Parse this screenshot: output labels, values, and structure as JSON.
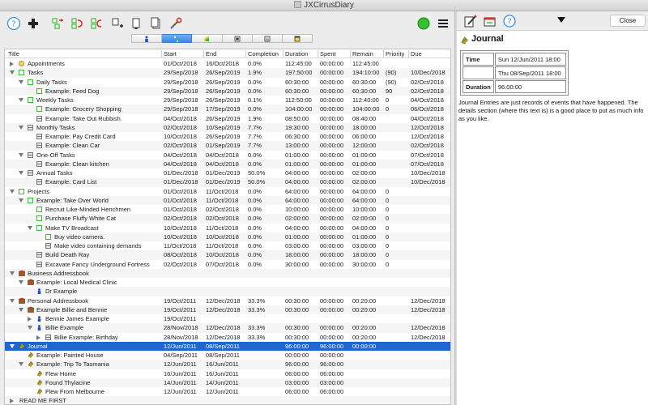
{
  "window": {
    "title": "JXCirrusDiary"
  },
  "toolbar": {
    "buttons": [
      "help-icon",
      "add-icon",
      "move-icon",
      "undo-icon",
      "redo-icon",
      "new-task-icon",
      "copy-icon",
      "paste-icon",
      "wrench-icon"
    ],
    "status_color": "#33c12f"
  },
  "tabs": [
    {
      "name": "person-tab"
    },
    {
      "name": "tree-tab"
    },
    {
      "name": "chart-tab"
    },
    {
      "name": "calendar-tab"
    },
    {
      "name": "week-tab"
    },
    {
      "name": "month-tab"
    }
  ],
  "table": {
    "headers": {
      "title": "Title",
      "start": "Start",
      "end": "End",
      "completion": "Completion",
      "duration": "Duration",
      "spent": "Spent",
      "remain": "Remain",
      "priority": "Priority",
      "due": "Due"
    },
    "rows": [
      {
        "indent": 0,
        "tri": "closed",
        "icon": "clock",
        "title": "Appointments",
        "start": "01/Oct/2018",
        "end": "16/Oct/2018",
        "completion": "0.0%",
        "duration": "112:45:00",
        "spent": "00:00:00",
        "remain": "112:45:00",
        "priority": "",
        "due": ""
      },
      {
        "indent": 0,
        "tri": "open",
        "icon": "task",
        "title": "Tasks",
        "start": "29/Sep/2018",
        "end": "26/Sep/2019",
        "completion": "1.9%",
        "duration": "197:50:00",
        "spent": "00:00:00",
        "remain": "194:10:00",
        "priority": "(90)",
        "due": "10/Dec/2018"
      },
      {
        "indent": 1,
        "tri": "open",
        "icon": "task",
        "title": "Daily Tasks",
        "start": "29/Sep/2018",
        "end": "26/Sep/2019",
        "completion": "0.0%",
        "duration": "60:30:00",
        "spent": "00:00:00",
        "remain": "60:30:00",
        "priority": "(90)",
        "due": "02/Oct/2018"
      },
      {
        "indent": 2,
        "tri": "",
        "icon": "task",
        "title": "Example: Feed Dog",
        "start": "29/Sep/2018",
        "end": "26/Sep/2019",
        "completion": "0.0%",
        "duration": "60:30:00",
        "spent": "00:00:00",
        "remain": "60:30:00",
        "priority": "90",
        "due": "02/Oct/2018"
      },
      {
        "indent": 1,
        "tri": "open",
        "icon": "task",
        "title": "Weekly Tasks",
        "start": "29/Sep/2018",
        "end": "26/Sep/2019",
        "completion": "0.1%",
        "duration": "112:50:00",
        "spent": "00:00:00",
        "remain": "112:40:00",
        "priority": "0",
        "due": "04/Oct/2018"
      },
      {
        "indent": 2,
        "tri": "",
        "icon": "task",
        "title": "Example: Grocery Shopping",
        "start": "29/Sep/2018",
        "end": "17/Sep/2019",
        "completion": "0.0%",
        "duration": "104:00:00",
        "spent": "00:00:00",
        "remain": "104:00:00",
        "priority": "0",
        "due": "06/Oct/2018"
      },
      {
        "indent": 2,
        "tri": "",
        "icon": "cal",
        "title": "Example: Take Out Rubbish",
        "start": "04/Oct/2018",
        "end": "26/Sep/2019",
        "completion": "1.9%",
        "duration": "08:50:00",
        "spent": "00:00:00",
        "remain": "08:40:00",
        "priority": "",
        "due": "04/Oct/2018"
      },
      {
        "indent": 1,
        "tri": "open",
        "icon": "cal",
        "title": "Monthly Tasks",
        "start": "02/Oct/2018",
        "end": "10/Sep/2019",
        "completion": "7.7%",
        "duration": "19:30:00",
        "spent": "00:00:00",
        "remain": "18:00:00",
        "priority": "",
        "due": "12/Oct/2018"
      },
      {
        "indent": 2,
        "tri": "",
        "icon": "cal",
        "title": "Example: Pay Credit Card",
        "start": "10/Oct/2018",
        "end": "26/Sep/2019",
        "completion": "7.7%",
        "duration": "06:30:00",
        "spent": "00:00:00",
        "remain": "06:00:00",
        "priority": "",
        "due": "12/Oct/2018"
      },
      {
        "indent": 2,
        "tri": "",
        "icon": "cal",
        "title": "Example: Clean Car",
        "start": "02/Oct/2018",
        "end": "01/Sep/2019",
        "completion": "7.7%",
        "duration": "13:00:00",
        "spent": "00:00:00",
        "remain": "12:00:00",
        "priority": "",
        "due": "02/Oct/2018"
      },
      {
        "indent": 1,
        "tri": "open",
        "icon": "cal",
        "title": "One-Off Tasks",
        "start": "04/Oct/2018",
        "end": "04/Oct/2018",
        "completion": "0.0%",
        "duration": "01:00:00",
        "spent": "00:00:00",
        "remain": "01:00:00",
        "priority": "",
        "due": "07/Oct/2018"
      },
      {
        "indent": 2,
        "tri": "",
        "icon": "cal",
        "title": "Example: Clean kitchen",
        "start": "04/Oct/2018",
        "end": "04/Oct/2018",
        "completion": "0.0%",
        "duration": "01:00:00",
        "spent": "00:00:00",
        "remain": "01:00:00",
        "priority": "",
        "due": "07/Oct/2018"
      },
      {
        "indent": 1,
        "tri": "open",
        "icon": "cal",
        "title": "Annual Tasks",
        "start": "01/Dec/2018",
        "end": "01/Dec/2019",
        "completion": "50.0%",
        "duration": "04:00:00",
        "spent": "00:00:00",
        "remain": "02:00:00",
        "priority": "",
        "due": "10/Dec/2018"
      },
      {
        "indent": 2,
        "tri": "",
        "icon": "cal",
        "title": "Example: Card List",
        "start": "01/Dec/2018",
        "end": "01/Dec/2019",
        "completion": "50.0%",
        "duration": "04:00:00",
        "spent": "00:00:00",
        "remain": "02:00:00",
        "priority": "",
        "due": "10/Dec/2018"
      },
      {
        "indent": 0,
        "tri": "open",
        "icon": "task",
        "title": "Projects",
        "start": "01/Oct/2018",
        "end": "11/Oct/2018",
        "completion": "0.0%",
        "duration": "64:00:00",
        "spent": "00:00:00",
        "remain": "64:00:00",
        "priority": "0",
        "due": ""
      },
      {
        "indent": 1,
        "tri": "open",
        "icon": "task",
        "title": "Example: Take Over World",
        "start": "01/Oct/2018",
        "end": "11/Oct/2018",
        "completion": "0.0%",
        "duration": "64:00:00",
        "spent": "00:00:00",
        "remain": "64:00:00",
        "priority": "0",
        "due": ""
      },
      {
        "indent": 2,
        "tri": "",
        "icon": "task",
        "title": "Recruit Like-Minded Henchmen",
        "start": "01/Oct/2018",
        "end": "02/Oct/2018",
        "completion": "0.0%",
        "duration": "10:00:00",
        "spent": "00:00:00",
        "remain": "10:00:00",
        "priority": "0",
        "due": ""
      },
      {
        "indent": 2,
        "tri": "",
        "icon": "task",
        "title": "Purchase Fluffy White Cat",
        "start": "02/Oct/2018",
        "end": "02/Oct/2018",
        "completion": "0.0%",
        "duration": "02:00:00",
        "spent": "00:00:00",
        "remain": "02:00:00",
        "priority": "0",
        "due": ""
      },
      {
        "indent": 2,
        "tri": "open",
        "icon": "task",
        "title": "Make TV Broadcast",
        "start": "10/Oct/2018",
        "end": "11/Oct/2018",
        "completion": "0.0%",
        "duration": "04:00:00",
        "spent": "00:00:00",
        "remain": "04:00:00",
        "priority": "0",
        "due": ""
      },
      {
        "indent": 3,
        "tri": "",
        "icon": "task",
        "title": "Buy video camera.",
        "start": "10/Oct/2018",
        "end": "10/Oct/2018",
        "completion": "0.0%",
        "duration": "01:00:00",
        "spent": "00:00:00",
        "remain": "01:00:00",
        "priority": "0",
        "due": ""
      },
      {
        "indent": 3,
        "tri": "",
        "icon": "cal",
        "title": "Make video containing demands",
        "start": "11/Oct/2018",
        "end": "11/Oct/2018",
        "completion": "0.0%",
        "duration": "03:00:00",
        "spent": "00:00:00",
        "remain": "03:00:00",
        "priority": "0",
        "due": ""
      },
      {
        "indent": 2,
        "tri": "",
        "icon": "cal",
        "title": "Build Death Ray",
        "start": "08/Oct/2018",
        "end": "10/Oct/2018",
        "completion": "0.0%",
        "duration": "18:00:00",
        "spent": "00:00:00",
        "remain": "18:00:00",
        "priority": "0",
        "due": ""
      },
      {
        "indent": 2,
        "tri": "",
        "icon": "cal",
        "title": "Excavate Fancy Underground Fortress",
        "start": "02/Oct/2018",
        "end": "07/Oct/2018",
        "completion": "0.0%",
        "duration": "30:00:00",
        "spent": "00:00:00",
        "remain": "30:00:00",
        "priority": "0",
        "due": ""
      },
      {
        "indent": 0,
        "tri": "open",
        "icon": "book",
        "title": "Business Addressbook",
        "start": "",
        "end": "",
        "completion": "",
        "duration": "",
        "spent": "",
        "remain": "",
        "priority": "",
        "due": ""
      },
      {
        "indent": 1,
        "tri": "open",
        "icon": "book",
        "title": "Example: Local Medical Clinic",
        "start": "",
        "end": "",
        "completion": "",
        "duration": "",
        "spent": "",
        "remain": "",
        "priority": "",
        "due": ""
      },
      {
        "indent": 2,
        "tri": "",
        "icon": "person",
        "title": "Dr Example",
        "start": "",
        "end": "",
        "completion": "",
        "duration": "",
        "spent": "",
        "remain": "",
        "priority": "",
        "due": ""
      },
      {
        "indent": 0,
        "tri": "open",
        "icon": "book",
        "title": "Personal Addressbook",
        "start": "19/Oct/2011",
        "end": "12/Dec/2018",
        "completion": "33.3%",
        "duration": "00:30:00",
        "spent": "00:00:00",
        "remain": "00:20:00",
        "priority": "",
        "due": "12/Dec/2018"
      },
      {
        "indent": 1,
        "tri": "open",
        "icon": "book",
        "title": "Example Billie and Bennie",
        "start": "19/Oct/2011",
        "end": "12/Dec/2018",
        "completion": "33.3%",
        "duration": "00:30:00",
        "spent": "00:00:00",
        "remain": "00:20:00",
        "priority": "",
        "due": "12/Dec/2018"
      },
      {
        "indent": 2,
        "tri": "closed",
        "icon": "person",
        "title": "Bennie James Example",
        "start": "19/Oct/2011",
        "end": "",
        "completion": "",
        "duration": "",
        "spent": "",
        "remain": "",
        "priority": "",
        "due": ""
      },
      {
        "indent": 2,
        "tri": "open",
        "icon": "person",
        "title": "Billie Example",
        "start": "28/Nov/2018",
        "end": "12/Dec/2018",
        "completion": "33.3%",
        "duration": "00:30:00",
        "spent": "00:00:00",
        "remain": "00:20:00",
        "priority": "",
        "due": "12/Dec/2018"
      },
      {
        "indent": 3,
        "tri": "closed",
        "icon": "cal",
        "title": "Billie Example: Birthday",
        "start": "28/Nov/2018",
        "end": "12/Dec/2018",
        "completion": "33.3%",
        "duration": "00:30:00",
        "spent": "00:00:00",
        "remain": "00:20:00",
        "priority": "",
        "due": "12/Dec/2018"
      },
      {
        "indent": 0,
        "tri": "open",
        "icon": "journal",
        "title": "Journal",
        "start": "12/Jun/2011",
        "end": "08/Sep/2011",
        "completion": "",
        "duration": "96:00:00",
        "spent": "96:00:00",
        "remain": "00:00:00",
        "priority": "",
        "due": "",
        "selected": true
      },
      {
        "indent": 1,
        "tri": "",
        "icon": "journal",
        "title": "Example: Painted House",
        "start": "04/Sep/2011",
        "end": "08/Sep/2011",
        "completion": "",
        "duration": "00:00:00",
        "spent": "00:00:00",
        "remain": "",
        "priority": "",
        "due": ""
      },
      {
        "indent": 1,
        "tri": "open",
        "icon": "journal",
        "title": "Example: Trip To Tasmania",
        "start": "12/Jun/2011",
        "end": "16/Jun/2011",
        "completion": "",
        "duration": "96:00:00",
        "spent": "96:00:00",
        "remain": "",
        "priority": "",
        "due": ""
      },
      {
        "indent": 2,
        "tri": "",
        "icon": "journal",
        "title": "Flew Home",
        "start": "16/Jun/2011",
        "end": "16/Jun/2011",
        "completion": "",
        "duration": "06:00:00",
        "spent": "06:00:00",
        "remain": "",
        "priority": "",
        "due": ""
      },
      {
        "indent": 2,
        "tri": "",
        "icon": "journal",
        "title": "Found Thylacine",
        "start": "14/Jun/2011",
        "end": "14/Jun/2011",
        "completion": "",
        "duration": "03:00:00",
        "spent": "03:00:00",
        "remain": "",
        "priority": "",
        "due": ""
      },
      {
        "indent": 2,
        "tri": "",
        "icon": "journal",
        "title": "Flew From Melbourne",
        "start": "12/Jun/2011",
        "end": "12/Jun/2011",
        "completion": "",
        "duration": "06:00:00",
        "spent": "06:00:00",
        "remain": "",
        "priority": "",
        "due": ""
      },
      {
        "indent": 0,
        "tri": "closed",
        "icon": "none",
        "title": "READ ME FIRST",
        "start": "",
        "end": "",
        "completion": "",
        "duration": "",
        "spent": "",
        "remain": "",
        "priority": "",
        "due": ""
      }
    ]
  },
  "detail": {
    "close_label": "Close",
    "title": "Journal",
    "fields": [
      {
        "key": "Time",
        "value": "Sun 12/Jun/2011 18:00"
      },
      {
        "key": "",
        "value": "Thu 08/Sep/2011 18:00"
      },
      {
        "key": "Duration",
        "value": "96:00:00"
      }
    ],
    "description": "Journal Entries are just records of events that have happened. The details section (where this text is) is a good place to put as much info as you like."
  }
}
